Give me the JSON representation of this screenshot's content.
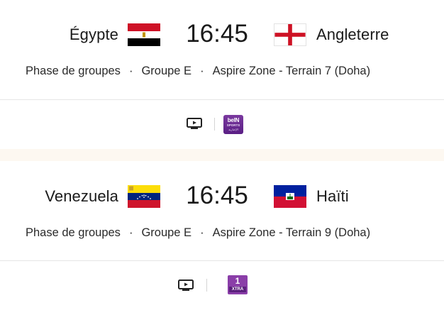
{
  "matches": [
    {
      "home_team": "Égypte",
      "away_team": "Angleterre",
      "time": "16:45",
      "phase": "Phase de groupes",
      "group": "Groupe E",
      "venue": "Aspire Zone - Terrain 7 (Doha)",
      "separator": "·",
      "broadcaster": {
        "line1": "beIN",
        "line2": "SPORTS",
        "line3": "الإخبارية"
      }
    },
    {
      "home_team": "Venezuela",
      "away_team": "Haïti",
      "time": "16:45",
      "phase": "Phase de groupes",
      "group": "Groupe E",
      "venue": "Aspire Zone - Terrain 9 (Doha)",
      "separator": "·",
      "broadcaster": {
        "number": "1",
        "label": "XTRA"
      }
    }
  ],
  "colors": {
    "separator_band": "#fdf8f1",
    "divider": "#e6e6e6",
    "bein_purple": "#6b2c92",
    "xtra_purple": "#8a3ea8"
  },
  "icons": [
    "tv-icon",
    "egypt-flag-icon",
    "england-flag-icon",
    "venezuela-flag-icon",
    "haiti-flag-icon"
  ]
}
